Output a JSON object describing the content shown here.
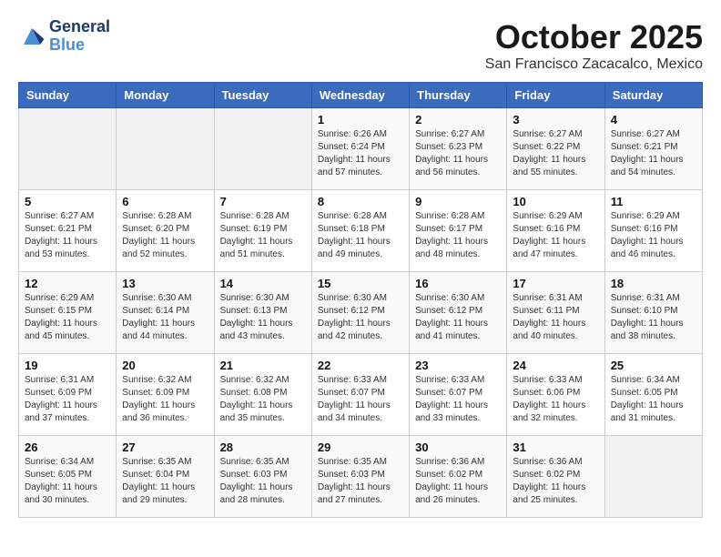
{
  "logo": {
    "line1": "General",
    "line2": "Blue"
  },
  "title": "October 2025",
  "location": "San Francisco Zacacalco, Mexico",
  "weekdays": [
    "Sunday",
    "Monday",
    "Tuesday",
    "Wednesday",
    "Thursday",
    "Friday",
    "Saturday"
  ],
  "weeks": [
    [
      {
        "day": "",
        "sunrise": "",
        "sunset": "",
        "daylight": ""
      },
      {
        "day": "",
        "sunrise": "",
        "sunset": "",
        "daylight": ""
      },
      {
        "day": "",
        "sunrise": "",
        "sunset": "",
        "daylight": ""
      },
      {
        "day": "1",
        "sunrise": "Sunrise: 6:26 AM",
        "sunset": "Sunset: 6:24 PM",
        "daylight": "Daylight: 11 hours and 57 minutes."
      },
      {
        "day": "2",
        "sunrise": "Sunrise: 6:27 AM",
        "sunset": "Sunset: 6:23 PM",
        "daylight": "Daylight: 11 hours and 56 minutes."
      },
      {
        "day": "3",
        "sunrise": "Sunrise: 6:27 AM",
        "sunset": "Sunset: 6:22 PM",
        "daylight": "Daylight: 11 hours and 55 minutes."
      },
      {
        "day": "4",
        "sunrise": "Sunrise: 6:27 AM",
        "sunset": "Sunset: 6:21 PM",
        "daylight": "Daylight: 11 hours and 54 minutes."
      }
    ],
    [
      {
        "day": "5",
        "sunrise": "Sunrise: 6:27 AM",
        "sunset": "Sunset: 6:21 PM",
        "daylight": "Daylight: 11 hours and 53 minutes."
      },
      {
        "day": "6",
        "sunrise": "Sunrise: 6:28 AM",
        "sunset": "Sunset: 6:20 PM",
        "daylight": "Daylight: 11 hours and 52 minutes."
      },
      {
        "day": "7",
        "sunrise": "Sunrise: 6:28 AM",
        "sunset": "Sunset: 6:19 PM",
        "daylight": "Daylight: 11 hours and 51 minutes."
      },
      {
        "day": "8",
        "sunrise": "Sunrise: 6:28 AM",
        "sunset": "Sunset: 6:18 PM",
        "daylight": "Daylight: 11 hours and 49 minutes."
      },
      {
        "day": "9",
        "sunrise": "Sunrise: 6:28 AM",
        "sunset": "Sunset: 6:17 PM",
        "daylight": "Daylight: 11 hours and 48 minutes."
      },
      {
        "day": "10",
        "sunrise": "Sunrise: 6:29 AM",
        "sunset": "Sunset: 6:16 PM",
        "daylight": "Daylight: 11 hours and 47 minutes."
      },
      {
        "day": "11",
        "sunrise": "Sunrise: 6:29 AM",
        "sunset": "Sunset: 6:16 PM",
        "daylight": "Daylight: 11 hours and 46 minutes."
      }
    ],
    [
      {
        "day": "12",
        "sunrise": "Sunrise: 6:29 AM",
        "sunset": "Sunset: 6:15 PM",
        "daylight": "Daylight: 11 hours and 45 minutes."
      },
      {
        "day": "13",
        "sunrise": "Sunrise: 6:30 AM",
        "sunset": "Sunset: 6:14 PM",
        "daylight": "Daylight: 11 hours and 44 minutes."
      },
      {
        "day": "14",
        "sunrise": "Sunrise: 6:30 AM",
        "sunset": "Sunset: 6:13 PM",
        "daylight": "Daylight: 11 hours and 43 minutes."
      },
      {
        "day": "15",
        "sunrise": "Sunrise: 6:30 AM",
        "sunset": "Sunset: 6:12 PM",
        "daylight": "Daylight: 11 hours and 42 minutes."
      },
      {
        "day": "16",
        "sunrise": "Sunrise: 6:30 AM",
        "sunset": "Sunset: 6:12 PM",
        "daylight": "Daylight: 11 hours and 41 minutes."
      },
      {
        "day": "17",
        "sunrise": "Sunrise: 6:31 AM",
        "sunset": "Sunset: 6:11 PM",
        "daylight": "Daylight: 11 hours and 40 minutes."
      },
      {
        "day": "18",
        "sunrise": "Sunrise: 6:31 AM",
        "sunset": "Sunset: 6:10 PM",
        "daylight": "Daylight: 11 hours and 38 minutes."
      }
    ],
    [
      {
        "day": "19",
        "sunrise": "Sunrise: 6:31 AM",
        "sunset": "Sunset: 6:09 PM",
        "daylight": "Daylight: 11 hours and 37 minutes."
      },
      {
        "day": "20",
        "sunrise": "Sunrise: 6:32 AM",
        "sunset": "Sunset: 6:09 PM",
        "daylight": "Daylight: 11 hours and 36 minutes."
      },
      {
        "day": "21",
        "sunrise": "Sunrise: 6:32 AM",
        "sunset": "Sunset: 6:08 PM",
        "daylight": "Daylight: 11 hours and 35 minutes."
      },
      {
        "day": "22",
        "sunrise": "Sunrise: 6:33 AM",
        "sunset": "Sunset: 6:07 PM",
        "daylight": "Daylight: 11 hours and 34 minutes."
      },
      {
        "day": "23",
        "sunrise": "Sunrise: 6:33 AM",
        "sunset": "Sunset: 6:07 PM",
        "daylight": "Daylight: 11 hours and 33 minutes."
      },
      {
        "day": "24",
        "sunrise": "Sunrise: 6:33 AM",
        "sunset": "Sunset: 6:06 PM",
        "daylight": "Daylight: 11 hours and 32 minutes."
      },
      {
        "day": "25",
        "sunrise": "Sunrise: 6:34 AM",
        "sunset": "Sunset: 6:05 PM",
        "daylight": "Daylight: 11 hours and 31 minutes."
      }
    ],
    [
      {
        "day": "26",
        "sunrise": "Sunrise: 6:34 AM",
        "sunset": "Sunset: 6:05 PM",
        "daylight": "Daylight: 11 hours and 30 minutes."
      },
      {
        "day": "27",
        "sunrise": "Sunrise: 6:35 AM",
        "sunset": "Sunset: 6:04 PM",
        "daylight": "Daylight: 11 hours and 29 minutes."
      },
      {
        "day": "28",
        "sunrise": "Sunrise: 6:35 AM",
        "sunset": "Sunset: 6:03 PM",
        "daylight": "Daylight: 11 hours and 28 minutes."
      },
      {
        "day": "29",
        "sunrise": "Sunrise: 6:35 AM",
        "sunset": "Sunset: 6:03 PM",
        "daylight": "Daylight: 11 hours and 27 minutes."
      },
      {
        "day": "30",
        "sunrise": "Sunrise: 6:36 AM",
        "sunset": "Sunset: 6:02 PM",
        "daylight": "Daylight: 11 hours and 26 minutes."
      },
      {
        "day": "31",
        "sunrise": "Sunrise: 6:36 AM",
        "sunset": "Sunset: 6:02 PM",
        "daylight": "Daylight: 11 hours and 25 minutes."
      },
      {
        "day": "",
        "sunrise": "",
        "sunset": "",
        "daylight": ""
      }
    ]
  ]
}
